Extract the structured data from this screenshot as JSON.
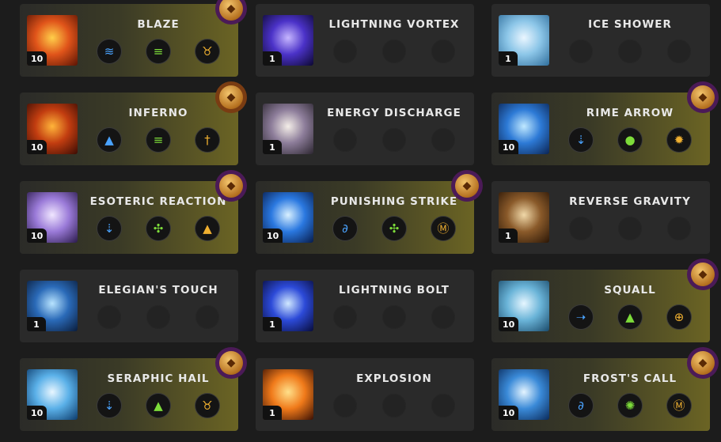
{
  "cards": [
    {
      "name": "BLAZE",
      "level": "10",
      "art": "fire1",
      "ranked": true,
      "badge": "purple",
      "runes": [
        {
          "icon": "waves-rune-icon",
          "glyph": "≋",
          "color": "#4aa3ff"
        },
        {
          "icon": "stack-rune-icon",
          "glyph": "≡",
          "color": "#7ddc3a"
        },
        {
          "icon": "bull-rune-icon",
          "glyph": "♉",
          "color": "#f0b030"
        }
      ]
    },
    {
      "name": "LIGHTNING VORTEX",
      "level": "1",
      "art": "vortex",
      "ranked": false,
      "runes": []
    },
    {
      "name": "ICE SHOWER",
      "level": "1",
      "art": "ice1",
      "ranked": false,
      "runes": []
    },
    {
      "name": "INFERNO",
      "level": "10",
      "art": "fire2",
      "ranked": true,
      "badge": "orange",
      "runes": [
        {
          "icon": "spire-rune-icon",
          "glyph": "▲",
          "color": "#4aa3ff"
        },
        {
          "icon": "stack-rune-icon",
          "glyph": "≡",
          "color": "#7ddc3a"
        },
        {
          "icon": "sword-rune-icon",
          "glyph": "†",
          "color": "#f0b030"
        }
      ]
    },
    {
      "name": "ENERGY DISCHARGE",
      "level": "1",
      "art": "energy",
      "ranked": false,
      "runes": []
    },
    {
      "name": "RIME ARROW",
      "level": "10",
      "art": "ice2",
      "ranked": true,
      "badge": "purple",
      "runes": [
        {
          "icon": "down-arrow-rune-icon",
          "glyph": "⇣",
          "color": "#4aa3ff"
        },
        {
          "icon": "orb-rune-icon",
          "glyph": "●",
          "color": "#7ddc3a"
        },
        {
          "icon": "sun-rune-icon",
          "glyph": "✹",
          "color": "#f0b030"
        }
      ]
    },
    {
      "name": "ESOTERIC REACTION",
      "level": "10",
      "art": "crystal",
      "ranked": true,
      "badge": "purple",
      "runes": [
        {
          "icon": "down-arrow-rune-icon",
          "glyph": "⇣",
          "color": "#4aa3ff"
        },
        {
          "icon": "swirl-rune-icon",
          "glyph": "✣",
          "color": "#7ddc3a"
        },
        {
          "icon": "spire-rune-icon",
          "glyph": "▲",
          "color": "#f0b030"
        }
      ]
    },
    {
      "name": "PUNISHING STRIKE",
      "level": "10",
      "art": "lightning1",
      "ranked": true,
      "badge": "purple",
      "runes": [
        {
          "icon": "spiral-rune-icon",
          "glyph": "∂",
          "color": "#4aa3ff"
        },
        {
          "icon": "swirl-rune-icon",
          "glyph": "✣",
          "color": "#7ddc3a"
        },
        {
          "icon": "gate-rune-icon",
          "glyph": "Ⓜ",
          "color": "#f0b030"
        }
      ]
    },
    {
      "name": "REVERSE GRAVITY",
      "level": "1",
      "art": "gravity",
      "ranked": false,
      "runes": []
    },
    {
      "name": "ELEGIAN'S TOUCH",
      "level": "1",
      "art": "elegian",
      "ranked": false,
      "runes": []
    },
    {
      "name": "LIGHTNING BOLT",
      "level": "1",
      "art": "lightning2",
      "ranked": false,
      "runes": []
    },
    {
      "name": "SQUALL",
      "level": "10",
      "art": "squall",
      "ranked": true,
      "badge": "purple",
      "runes": [
        {
          "icon": "dash-rune-icon",
          "glyph": "➝",
          "color": "#4aa3ff"
        },
        {
          "icon": "flame-rune-icon",
          "glyph": "▲",
          "color": "#7ddc3a"
        },
        {
          "icon": "eye-rune-icon",
          "glyph": "⊕",
          "color": "#f0b030"
        }
      ]
    },
    {
      "name": "SERAPHIC HAIL",
      "level": "10",
      "art": "hail",
      "ranked": true,
      "badge": "purple",
      "runes": [
        {
          "icon": "down-arrow-rune-icon",
          "glyph": "⇣",
          "color": "#4aa3ff"
        },
        {
          "icon": "spire-rune-icon",
          "glyph": "▲",
          "color": "#7ddc3a"
        },
        {
          "icon": "bull-rune-icon",
          "glyph": "♉",
          "color": "#f0b030"
        }
      ]
    },
    {
      "name": "EXPLOSION",
      "level": "1",
      "art": "explosion",
      "ranked": false,
      "runes": []
    },
    {
      "name": "FROST'S CALL",
      "level": "10",
      "art": "frost",
      "ranked": true,
      "badge": "purple",
      "runes": [
        {
          "icon": "spiral-rune-icon",
          "glyph": "∂",
          "color": "#4aa3ff"
        },
        {
          "icon": "burst-rune-icon",
          "glyph": "✺",
          "color": "#7ddc3a"
        },
        {
          "icon": "gate-rune-icon",
          "glyph": "Ⓜ",
          "color": "#f0b030"
        }
      ]
    }
  ],
  "art_colors": {
    "fire1": [
      "#ffcf4a",
      "#e0541a",
      "#5a1404"
    ],
    "fire2": [
      "#ffb43a",
      "#c23d10",
      "#3a0c04"
    ],
    "vortex": [
      "#c6b6ff",
      "#4b32c8",
      "#0c0830"
    ],
    "ice1": [
      "#eaf6ff",
      "#8cc6e8",
      "#2f6e9c"
    ],
    "energy": [
      "#f4eee8",
      "#8d7d9a",
      "#2c2630"
    ],
    "ice2": [
      "#bfe8ff",
      "#2d7ad6",
      "#0b2452"
    ],
    "crystal": [
      "#f0e6ff",
      "#9a7ad8",
      "#2a1a4a"
    ],
    "lightning1": [
      "#d8f0ff",
      "#2a78e0",
      "#081c4a"
    ],
    "gravity": [
      "#f0d8a8",
      "#8a5a2a",
      "#2a1606"
    ],
    "elegian": [
      "#b8e4ff",
      "#2a6ab8",
      "#0a1c3a"
    ],
    "lightning2": [
      "#d0e8ff",
      "#2c4ad8",
      "#080c3a"
    ],
    "squall": [
      "#e6f6ff",
      "#6ab4d8",
      "#1a4a6a"
    ],
    "hail": [
      "#e8f6ff",
      "#5ab0e8",
      "#0c3a6a"
    ],
    "explosion": [
      "#ffe08a",
      "#f07a1a",
      "#3a1004"
    ],
    "frost": [
      "#e4f4ff",
      "#3a8ad8",
      "#0a2a5a"
    ]
  }
}
